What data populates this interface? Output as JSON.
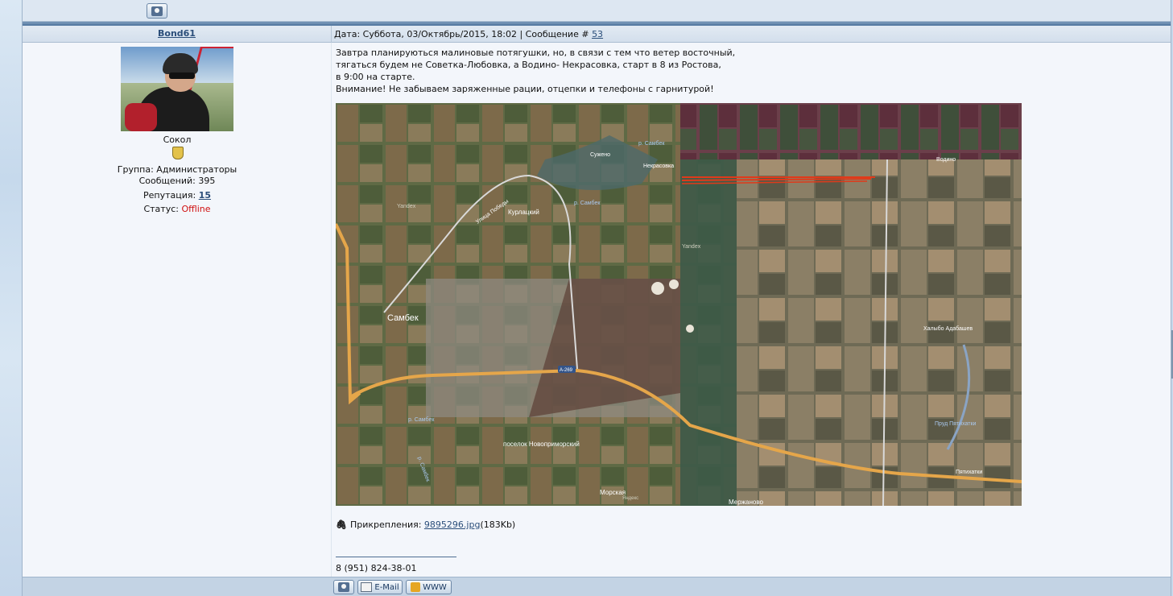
{
  "post": {
    "author": "Bond61",
    "date_label": "Дата: Суббота, 03/Октябрь/2015, 18:02 | Сообщение # ",
    "message_number": "53",
    "text": "Завтра планируються малиновые потягушки, но, в связи с тем что ветер восточный,\nтягаться будем не Советка-Любовка, а Водино- Некрасовка, старт в 8 из Ростова,\nв 9:00 на старте.\nВнимание! Не забываем заряженные рации, отцепки и телефоны с гарнитурой!"
  },
  "user": {
    "rank": "Сокол",
    "group": "Группа: Администраторы",
    "messages": "Сообщений: 395",
    "reputation_label": "Репутация: ",
    "reputation_value": "15",
    "status_label": "Статус: ",
    "status_value": "Offline"
  },
  "map": {
    "labels": {
      "sambek": "Самбек",
      "kurlatsky": "Курлацкий",
      "ulitsa": "Улица Победы",
      "suzheno": "Сужено",
      "nekrasovka": "Некрасовка",
      "vodino": "Водино",
      "river1": "р. Самбек",
      "river2": "р. Самбек",
      "river3": "р. Самбек",
      "river4": "р. Самбек",
      "novoprimorsky": "поселок Новоприморский",
      "morskaya": "Морская",
      "merzhanovo": "Мержаново",
      "khalybo": "Халыбо Адабашев",
      "prud": "Пруд Пятихатки",
      "pyatikhatki": "Пятихатки",
      "road": "А-269",
      "yandex1": "Yandex",
      "yandex2": "Yandex",
      "yandex3": "Яндекс"
    }
  },
  "attachment": {
    "label": "Прикрепления: ",
    "file": "9895296.jpg",
    "size": "(183Kb)"
  },
  "signature": {
    "phone": "8 (951) 824-38-01"
  },
  "buttons": {
    "email": "E-Mail",
    "www": "WWW"
  },
  "colors": {
    "link": "#2b4e7a",
    "offline": "#d01010",
    "header_bar": "#5b7fa6"
  }
}
